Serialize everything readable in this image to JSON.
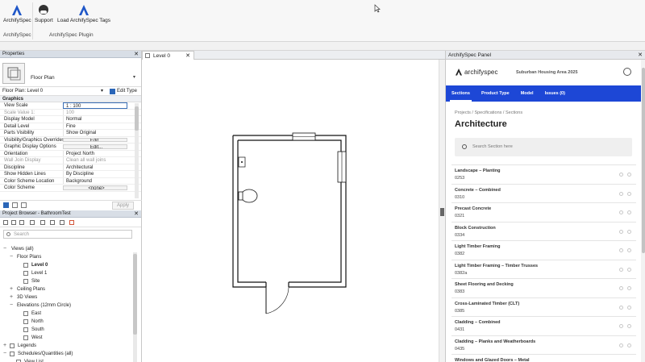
{
  "ribbon": {
    "buttons": [
      {
        "label": "ArchifySpec"
      },
      {
        "label": "Support"
      },
      {
        "label": "Load ArchifySpec Tags"
      }
    ],
    "groups": [
      "ArchifySpec",
      "ArchifySpec Plugin"
    ]
  },
  "properties": {
    "title": "Properties",
    "type_name": "Floor Plan",
    "instance": "Floor Plan: Level 0",
    "edit_type": "Edit Type",
    "group": "Graphics",
    "rows": [
      {
        "k": "View Scale",
        "v": "1 : 100"
      },
      {
        "k": "Scale Value    1:",
        "v": "100"
      },
      {
        "k": "Display Model",
        "v": "Normal"
      },
      {
        "k": "Detail Level",
        "v": "Fine"
      },
      {
        "k": "Parts Visibility",
        "v": "Show Original"
      },
      {
        "k": "Visibility/Graphics Overrides",
        "v": "Edit..."
      },
      {
        "k": "Graphic Display Options",
        "v": "Edit..."
      },
      {
        "k": "Orientation",
        "v": "Project North"
      },
      {
        "k": "Wall Join Display",
        "v": "Clean all wall joins"
      },
      {
        "k": "Discipline",
        "v": "Architectural"
      },
      {
        "k": "Show Hidden Lines",
        "v": "By Discipline"
      },
      {
        "k": "Color Scheme Location",
        "v": "Background"
      },
      {
        "k": "Color Scheme",
        "v": "<none>"
      }
    ],
    "apply": "Apply"
  },
  "browser": {
    "title": "Project Browser - BathroomTest",
    "search_placeholder": "Search",
    "tree": [
      {
        "label": "Views (all)"
      },
      {
        "label": "Floor Plans"
      },
      {
        "label": "Level 0"
      },
      {
        "label": "Level 1"
      },
      {
        "label": "Site"
      },
      {
        "label": "Ceiling Plans"
      },
      {
        "label": "3D Views"
      },
      {
        "label": "Elevations (12mm Circle)"
      },
      {
        "label": "East"
      },
      {
        "label": "North"
      },
      {
        "label": "South"
      },
      {
        "label": "West"
      },
      {
        "label": "Legends"
      },
      {
        "label": "Schedules/Quantities (all)"
      },
      {
        "label": "View List"
      }
    ]
  },
  "view_tab": {
    "label": "Level 0"
  },
  "spec": {
    "panel_title": "ArchifySpec Panel",
    "logo_text": "archifyspec",
    "project_name": "Suburban Housing Area 2025",
    "nav": [
      {
        "label": "Sections"
      },
      {
        "label": "Product Type"
      },
      {
        "label": "Model"
      },
      {
        "label": "Issues (0)"
      }
    ],
    "breadcrumb": "Projects / Specifications / Sections",
    "heading": "Architecture",
    "search_placeholder": "Search Section here",
    "sections": [
      {
        "name": "Landscape – Planting",
        "code": "0253"
      },
      {
        "name": "Concrete – Combined",
        "code": "0310"
      },
      {
        "name": "Precast Concrete",
        "code": "0321"
      },
      {
        "name": "Block Construction",
        "code": "0334"
      },
      {
        "name": "Light Timber Framing",
        "code": "0382"
      },
      {
        "name": "Light Timber Framing – Timber Trusses",
        "code": "0382a"
      },
      {
        "name": "Sheet Flooring and Decking",
        "code": "0383"
      },
      {
        "name": "Cross-Laminated Timber (CLT)",
        "code": "0385"
      },
      {
        "name": "Cladding – Combined",
        "code": "0431"
      },
      {
        "name": "Cladding – Planks and Weatherboards",
        "code": "0435"
      },
      {
        "name": "Windows and Glazed Doors – Metal",
        "code": ""
      }
    ],
    "accent": "#1d47d6"
  }
}
